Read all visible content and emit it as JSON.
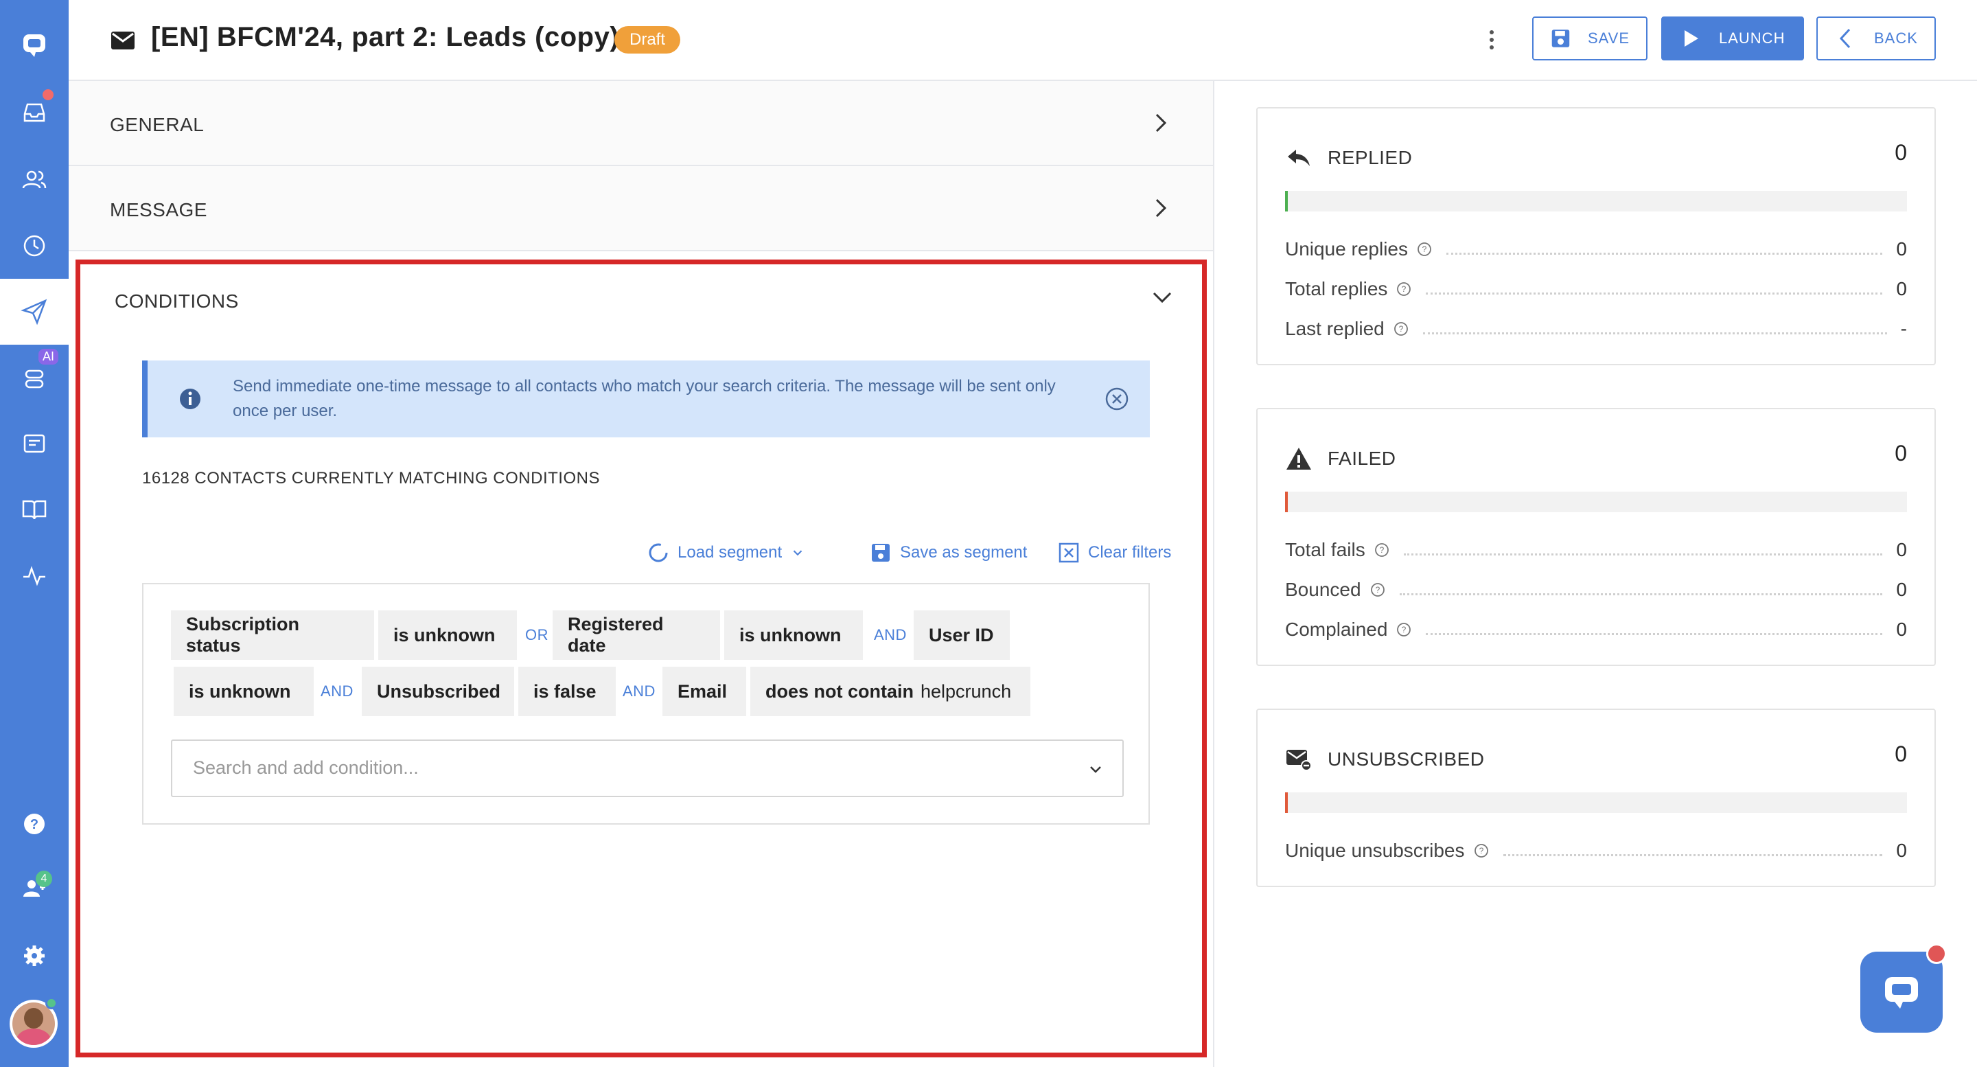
{
  "header": {
    "title": "[EN] BFCM'24, part 2: Leads (copy)",
    "status": "Draft",
    "save_label": "SAVE",
    "launch_label": "LAUNCH",
    "back_label": "BACK"
  },
  "nav": {
    "ai_badge": "AI",
    "team_count": "4"
  },
  "sections": {
    "general": "GENERAL",
    "message": "MESSAGE",
    "conditions": "CONDITIONS"
  },
  "conditions": {
    "info": "Send immediate one-time message to all contacts who match your search criteria. The message will be sent only once per user.",
    "matching": "16128 CONTACTS CURRENTLY MATCHING CONDITIONS",
    "load_segment": "Load segment",
    "save_segment": "Save as segment",
    "clear_filters": "Clear filters",
    "filters": {
      "c1": "Subscription status",
      "c2": "is unknown",
      "op1": "OR",
      "c3": "Registered date",
      "c4": "is unknown",
      "op2": "AND",
      "c5": "User ID",
      "c6": "is unknown",
      "op3": "AND",
      "c7": "Unsubscribed",
      "c8": "is false",
      "op4": "AND",
      "c9": "Email",
      "c10": "does not contain",
      "c10_value": "helpcrunch"
    },
    "search_placeholder": "Search and add condition..."
  },
  "stats": {
    "replied": {
      "title": "REPLIED",
      "count": "0",
      "rows": [
        {
          "label": "Unique replies",
          "value": "0"
        },
        {
          "label": "Total replies",
          "value": "0"
        },
        {
          "label": "Last replied",
          "value": "-"
        }
      ]
    },
    "failed": {
      "title": "FAILED",
      "count": "0",
      "rows": [
        {
          "label": "Total fails",
          "value": "0"
        },
        {
          "label": "Bounced",
          "value": "0"
        },
        {
          "label": "Complained",
          "value": "0"
        }
      ]
    },
    "unsubscribed": {
      "title": "UNSUBSCRIBED",
      "count": "0",
      "rows": [
        {
          "label": "Unique unsubscribes",
          "value": "0"
        }
      ]
    }
  },
  "colors": {
    "nav_bg": "#4a7fd8",
    "draft": "#f0a03a",
    "highlight_border": "#d62828",
    "replied_bar": "#4caf50",
    "failed_bar": "#e05a3a"
  }
}
